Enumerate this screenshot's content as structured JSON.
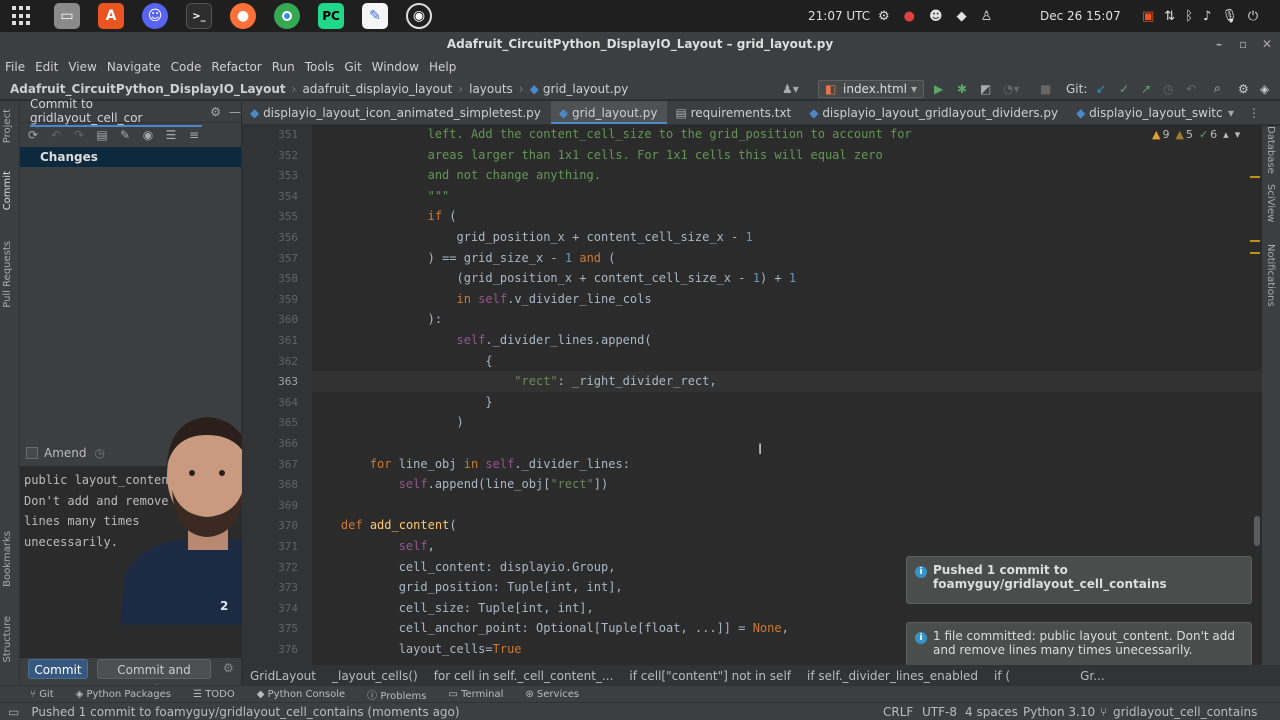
{
  "os_bar": {
    "clock": "21:07 UTC",
    "date": "Dec 26  15:07"
  },
  "window": {
    "title": "Adafruit_CircuitPython_DisplayIO_Layout – grid_layout.py"
  },
  "menu": [
    "File",
    "Edit",
    "View",
    "Navigate",
    "Code",
    "Refactor",
    "Run",
    "Tools",
    "Git",
    "Window",
    "Help"
  ],
  "nav": {
    "crumbs": [
      "Adafruit_CircuitPython_DisplayIO_Layout",
      "adafruit_displayio_layout",
      "layouts",
      "grid_layout.py"
    ],
    "run_config": "index.html",
    "git_label": "Git:"
  },
  "commit_panel": {
    "tab_label": "Commit to gridlayout_cell_cor",
    "changes_label": "Changes",
    "amend_label": "Amend",
    "message_lines": [
      "public layout_content.",
      "Don't add and remove",
      "lines many times",
      "unecessarily."
    ],
    "commit_button": "Commit",
    "commit_push_button": "Commit and Push..."
  },
  "left_strip_tabs": [
    "Project",
    "Commit",
    "Pull Requests",
    "Bookmarks",
    "Structure"
  ],
  "right_strip_tabs": [
    "Database",
    "SciView",
    "Notifications"
  ],
  "editor_tabs": [
    {
      "label": "displayio_layout_icon_animated_simpletest.py",
      "active": false
    },
    {
      "label": "grid_layout.py",
      "active": true
    },
    {
      "label": "requirements.txt",
      "active": false
    },
    {
      "label": "displayio_layout_gridlayout_dividers.py",
      "active": false
    },
    {
      "label": "displayio_layout_switc",
      "active": false
    }
  ],
  "inspection": {
    "warnings": "9",
    "weak": "5",
    "ok": "6"
  },
  "line_numbers": [
    "351",
    "352",
    "353",
    "354",
    "355",
    "356",
    "357",
    "358",
    "359",
    "360",
    "361",
    "362",
    "363",
    "364",
    "365",
    "366",
    "367",
    "368",
    "369",
    "370",
    "371",
    "372",
    "373",
    "374",
    "375",
    "376"
  ],
  "current_line": "363",
  "code_lines": [
    "                left. Add the content_cell_size to the grid_position to account for",
    "                areas larger than 1x1 cells. For 1x1 cells this will equal zero",
    "                and not change anything.",
    "                \"\"\"",
    "                if (",
    "                    grid_position_x + content_cell_size_x - 1",
    "                ) == grid_size_x - 1 and (",
    "                    (grid_position_x + content_cell_size_x - 1) + 1",
    "                    in self.v_divider_line_cols",
    "                ):",
    "                    self._divider_lines.append(",
    "                        {",
    "                            \"rect\": _right_divider_rect,",
    "                        }",
    "                    )",
    "",
    "        for line_obj in self._divider_lines:",
    "            self.append(line_obj[\"rect\"])",
    "",
    "    def add_content(",
    "            self,",
    "            cell_content: displayio.Group,",
    "            grid_position: Tuple[int, int],",
    "            cell_size: Tuple[int, int],",
    "            cell_anchor_point: Optional[Tuple[float, ...]] = None,",
    "            layout_cells=True"
  ],
  "code_breadcrumbs": [
    "GridLayout",
    "_layout_cells()",
    "for cell in self._cell_content_...",
    "if cell[\"content\"] not in self",
    "if self._divider_lines_enabled",
    "if (",
    "Gr..."
  ],
  "bottom_tools": [
    "Git",
    "Python Packages",
    "TODO",
    "Python Console",
    "Problems",
    "Terminal",
    "Services"
  ],
  "status": {
    "message": "Pushed 1 commit to foamyguy/gridlayout_cell_contains (moments ago)",
    "line_sep": "CRLF",
    "encoding": "UTF-8",
    "indent": "4 spaces",
    "interpreter": "Python 3.10",
    "branch": "gridlayout_cell_contains"
  },
  "notifications": [
    {
      "text1": "Pushed 1 commit to",
      "text2": "foamyguy/gridlayout_cell_contains"
    },
    {
      "text1": "1 file committed: public layout_content. Don't add",
      "text2": "and remove lines many times unecessarily."
    }
  ],
  "colors": {
    "accent": "#4a88c7",
    "commit_button": "#365880",
    "info": "#3592c4"
  }
}
